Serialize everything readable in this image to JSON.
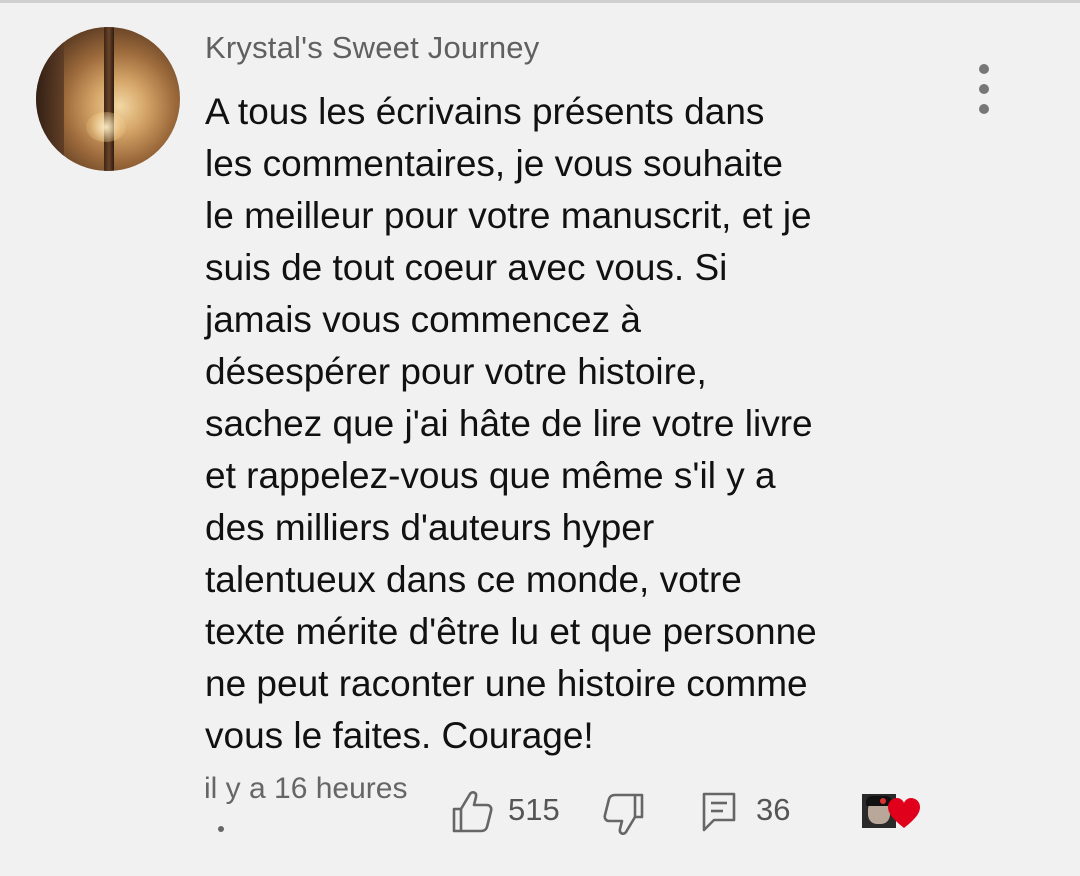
{
  "comment": {
    "author": "Krystal's Sweet Journey",
    "text_lines": [
      "A tous les écrivains présents dans",
      "les commentaires, je vous souhaite",
      "le meilleur pour votre manuscrit, et je",
      "suis de tout coeur avec vous. Si",
      "jamais vous commencez à",
      "désespérer pour votre histoire,",
      "sachez que j'ai hâte de lire votre livre",
      "et rappelez-vous que même s'il y a",
      "des milliers d'auteurs hyper",
      "talentueux dans ce monde, votre",
      "texte mérite d'être lu et que personne",
      "ne peut raconter une histoire comme",
      "vous le faites. Courage!"
    ],
    "timestamp": "il y a 16 heures",
    "likes": "515",
    "replies": "36"
  },
  "icons": {
    "avatar": "user-avatar",
    "menu": "more-vert-icon",
    "like": "thumbs-up-icon",
    "dislike": "thumbs-down-icon",
    "reply": "reply-icon",
    "creator_heart": "creator-heart-icon"
  },
  "colors": {
    "background": "#f1f1f1",
    "text": "#111111",
    "meta": "#606060",
    "heart": "#e0001b"
  }
}
